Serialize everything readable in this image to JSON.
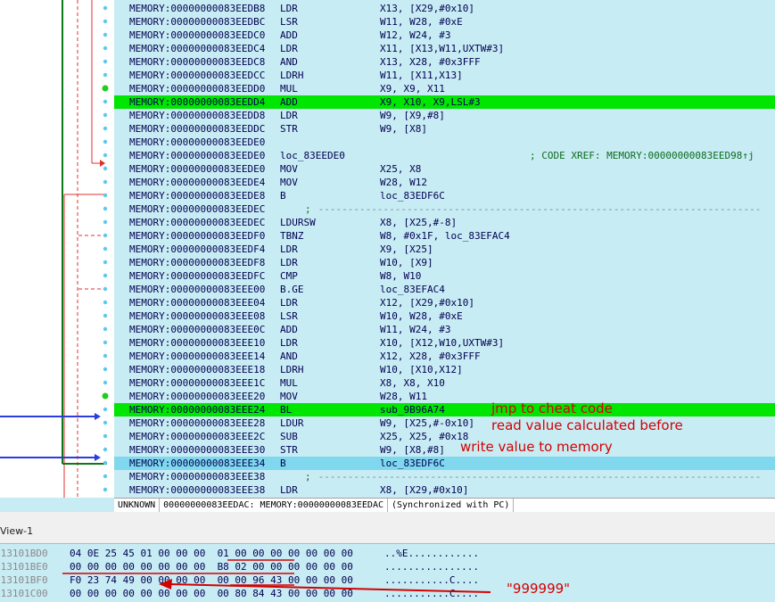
{
  "listing": {
    "rows": [
      {
        "addr": "MEMORY:00000000083EEDB8",
        "mn": "LDR",
        "op": "X13, [X29,#0x10]"
      },
      {
        "addr": "MEMORY:00000000083EEDBC",
        "mn": "LSR",
        "op": "W11, W28, #0xE"
      },
      {
        "addr": "MEMORY:00000000083EEDC0",
        "mn": "ADD",
        "op": "W12, W24, #3"
      },
      {
        "addr": "MEMORY:00000000083EEDC4",
        "mn": "LDR",
        "op": "X11, [X13,W11,UXTW#3]"
      },
      {
        "addr": "MEMORY:00000000083EEDC8",
        "mn": "AND",
        "op": "X13, X28, #0x3FFF"
      },
      {
        "addr": "MEMORY:00000000083EEDCC",
        "mn": "LDRH",
        "op": "W11, [X11,X13]"
      },
      {
        "addr": "MEMORY:00000000083EEDD0",
        "mn": "MUL",
        "op": "X9, X9, X11"
      },
      {
        "addr": "MEMORY:00000000083EEDD4",
        "mn": "ADD",
        "op": "X9, X10, X9,LSL#3",
        "hl": "green"
      },
      {
        "addr": "MEMORY:00000000083EEDD8",
        "mn": "LDR",
        "op": "W9, [X9,#8]"
      },
      {
        "addr": "MEMORY:00000000083EEDDC",
        "mn": "STR",
        "op": "W9, [X8]"
      },
      {
        "addr": "MEMORY:00000000083EEDE0",
        "mn": "",
        "op": ""
      },
      {
        "addr": "MEMORY:00000000083EEDE0",
        "mn": "loc_83EEDE0",
        "op": "",
        "cmt": "; CODE XREF: MEMORY:00000000083EED98↑j"
      },
      {
        "addr": "MEMORY:00000000083EEDE0",
        "mn": "MOV",
        "op": "X25, X8"
      },
      {
        "addr": "MEMORY:00000000083EEDE4",
        "mn": "MOV",
        "op": "W28, W12"
      },
      {
        "addr": "MEMORY:00000000083EEDE8",
        "mn": "B",
        "op": "loc_83EDF6C"
      },
      {
        "addr": "MEMORY:00000000083EEDEC",
        "sep": true,
        "semi": ";",
        "dash": " ---------------------------------------------------------------------------"
      },
      {
        "addr": "MEMORY:00000000083EEDEC",
        "mn": "LDURSW",
        "op": "X8, [X25,#-8]"
      },
      {
        "addr": "MEMORY:00000000083EEDF0",
        "mn": "TBNZ",
        "op": "W8, #0x1F, loc_83EFAC4"
      },
      {
        "addr": "MEMORY:00000000083EEDF4",
        "mn": "LDR",
        "op": "X9, [X25]"
      },
      {
        "addr": "MEMORY:00000000083EEDF8",
        "mn": "LDR",
        "op": "W10, [X9]"
      },
      {
        "addr": "MEMORY:00000000083EEDFC",
        "mn": "CMP",
        "op": "W8, W10"
      },
      {
        "addr": "MEMORY:00000000083EEE00",
        "mn": "B.GE",
        "op": "loc_83EFAC4"
      },
      {
        "addr": "MEMORY:00000000083EEE04",
        "mn": "LDR",
        "op": "X12, [X29,#0x10]"
      },
      {
        "addr": "MEMORY:00000000083EEE08",
        "mn": "LSR",
        "op": "W10, W28, #0xE"
      },
      {
        "addr": "MEMORY:00000000083EEE0C",
        "mn": "ADD",
        "op": "W11, W24, #3"
      },
      {
        "addr": "MEMORY:00000000083EEE10",
        "mn": "LDR",
        "op": "X10, [X12,W10,UXTW#3]"
      },
      {
        "addr": "MEMORY:00000000083EEE14",
        "mn": "AND",
        "op": "X12, X28, #0x3FFF"
      },
      {
        "addr": "MEMORY:00000000083EEE18",
        "mn": "LDRH",
        "op": "W10, [X10,X12]"
      },
      {
        "addr": "MEMORY:00000000083EEE1C",
        "mn": "MUL",
        "op": "X8, X8, X10"
      },
      {
        "addr": "MEMORY:00000000083EEE20",
        "mn": "MOV",
        "op": "W28, W11"
      },
      {
        "addr": "MEMORY:00000000083EEE24",
        "mn": "BL",
        "op": "sub_9B96A74",
        "hl": "green"
      },
      {
        "addr": "MEMORY:00000000083EEE28",
        "mn": "LDUR",
        "op": "W9, [X25,#-0x10]"
      },
      {
        "addr": "MEMORY:00000000083EEE2C",
        "mn": "SUB",
        "op": "X25, X25, #0x18"
      },
      {
        "addr": "MEMORY:00000000083EEE30",
        "mn": "STR",
        "op": "W9, [X8,#8]"
      },
      {
        "addr": "MEMORY:00000000083EEE34",
        "mn": "B",
        "op": "loc_83EDF6C",
        "hl": "blue"
      },
      {
        "addr": "MEMORY:00000000083EEE38",
        "sep": true,
        "semi": ";",
        "dash": " ---------------------------------------------------------------------------"
      },
      {
        "addr": "MEMORY:00000000083EEE38",
        "mn": "LDR",
        "op": "X8, [X29,#0x10]"
      }
    ]
  },
  "annotations": {
    "jmp": "jmp to cheat code",
    "read": "read value calculated before",
    "write": "write value to memory",
    "value": "\"999999\""
  },
  "statusbar": {
    "segment": "UNKNOWN",
    "location": "00000000083EEDAC: MEMORY:00000000083EEDAC",
    "sync": "(Synchronized with PC)"
  },
  "hex_panel": {
    "title": "View-1",
    "rows": [
      {
        "addr": "013101BD0",
        "bytes": "04 0E 25 45 01 00 00 00  01 00 00 00 00 00 00 00",
        "ascii": "..%E............"
      },
      {
        "addr": "013101BE0",
        "bytes": "00 00 00 00 00 00 00 00  B8 02 00 00 00 00 00 00",
        "ascii": "................"
      },
      {
        "addr": "013101BF0",
        "bytes": "F0 23 74 49 00 00 00 00  00 00 96 43 00 00 00 00",
        "ascii": "...........C...."
      },
      {
        "addr": "013101C00",
        "bytes": "00 00 00 00 00 00 00 00  00 80 84 43 00 00 00 00",
        "ascii": "...........C...."
      }
    ]
  },
  "colors": {
    "listing_bg": "#c8ecf4",
    "current_line_green": "#00e600",
    "selected_line_blue": "#7fd8ee",
    "annotation_red": "#d40000",
    "flow_blue": "#2a3de0",
    "flow_green": "#0a7a16"
  }
}
